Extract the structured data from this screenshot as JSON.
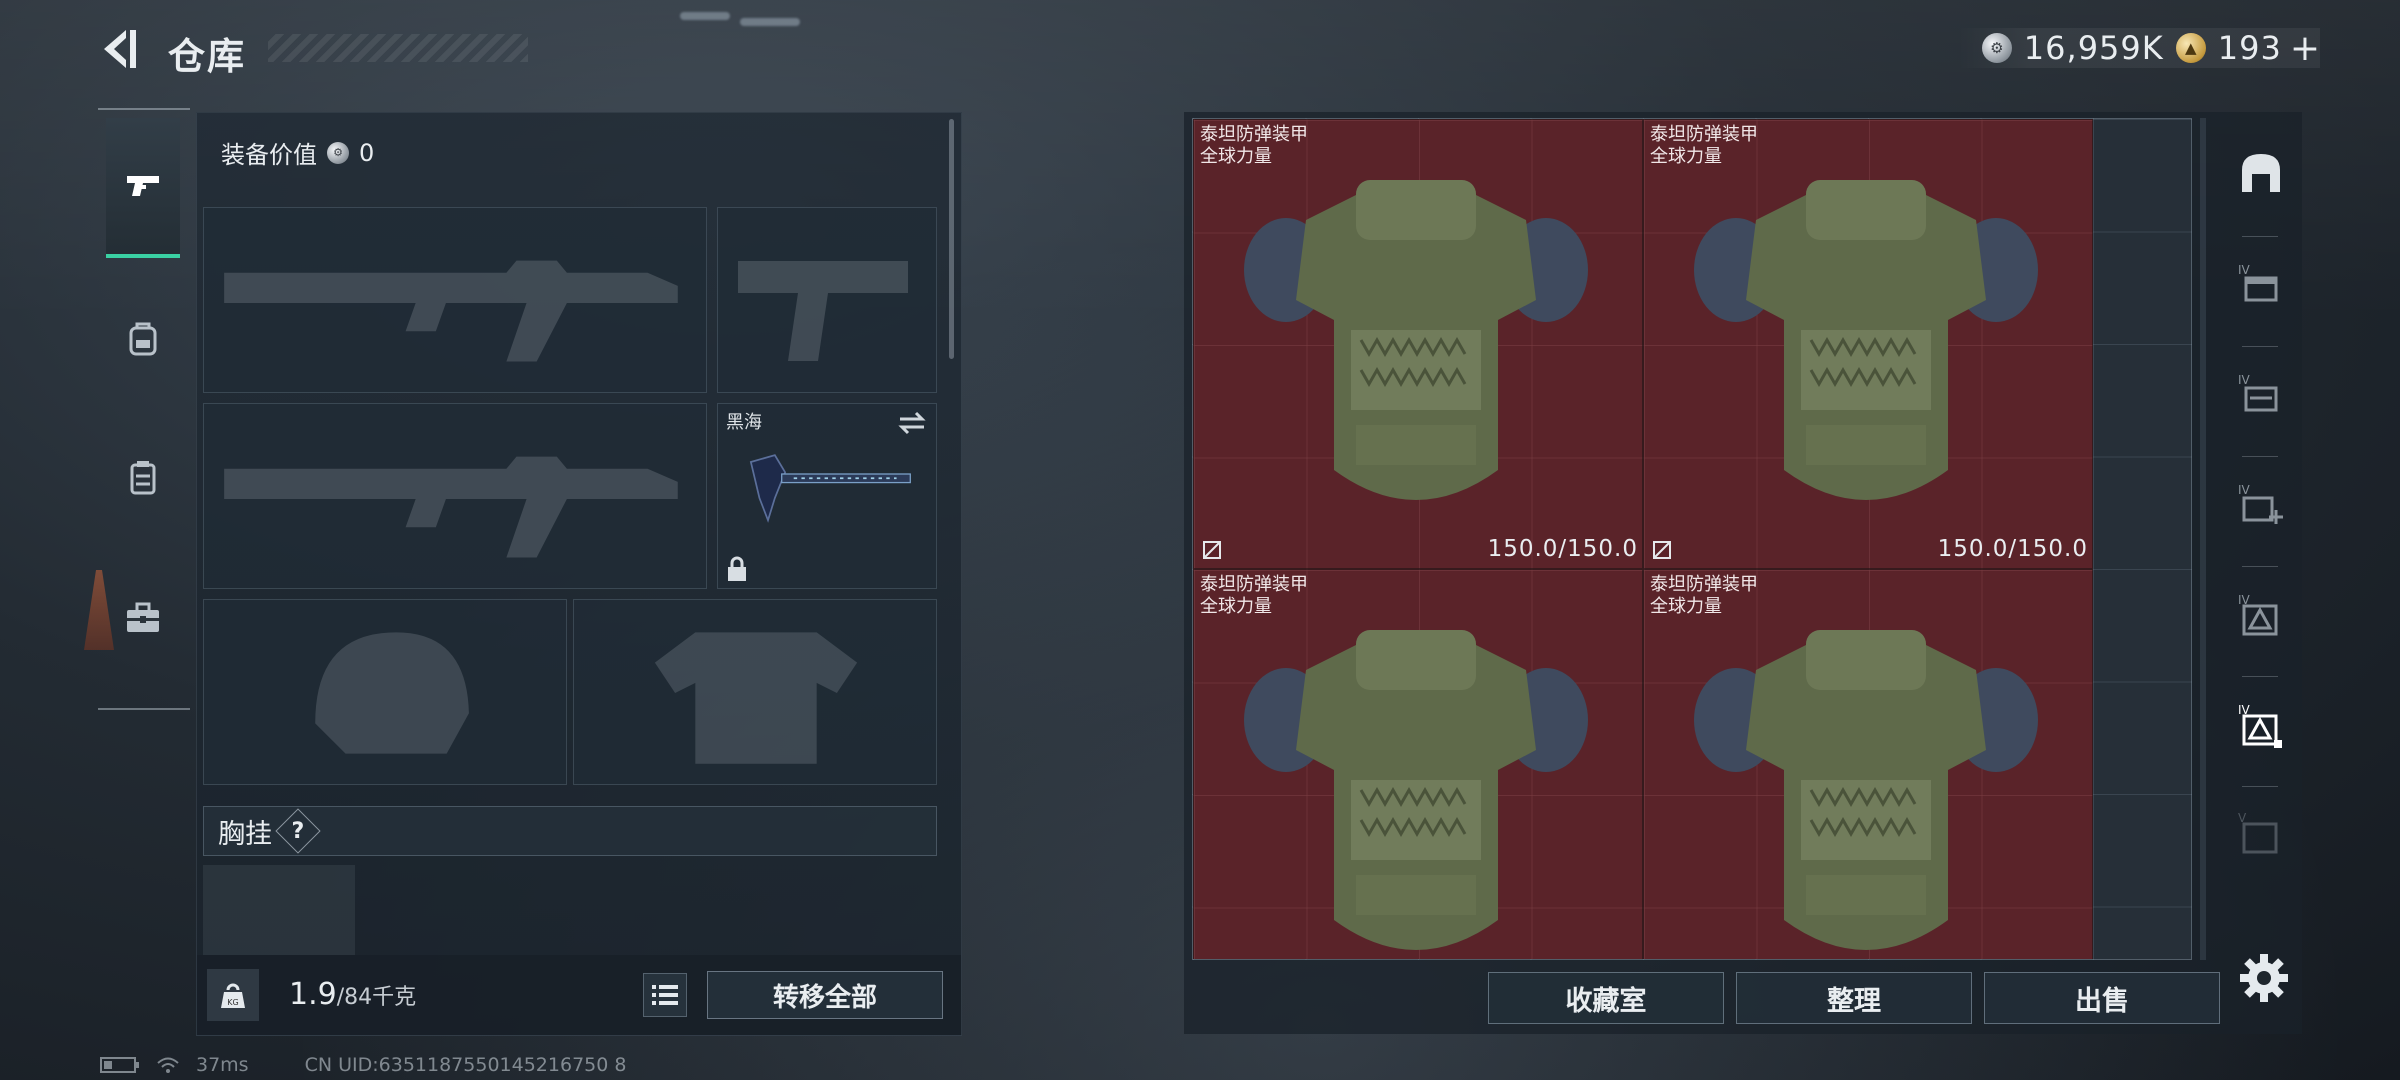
{
  "header": {
    "title": "仓库",
    "currency": {
      "silver": {
        "value": "16,959K",
        "icon": "silver-coin-icon"
      },
      "gold": {
        "value": "193",
        "icon": "gold-coin-icon"
      },
      "add_label": "+"
    }
  },
  "left_tabs": [
    {
      "icon": "pistol-icon",
      "active": true
    },
    {
      "icon": "backpack-icon",
      "active": false
    },
    {
      "icon": "chest-rig-icon",
      "active": false
    },
    {
      "icon": "toolbox-icon",
      "active": false
    }
  ],
  "equipment": {
    "value_label": "装备价值",
    "value": "0",
    "slots": [
      {
        "id": "primary-weapon-1",
        "label": "",
        "empty": true
      },
      {
        "id": "pistol",
        "label": "",
        "empty": true
      },
      {
        "id": "primary-weapon-2",
        "label": "",
        "empty": true
      },
      {
        "id": "melee",
        "label": "黑海",
        "empty": false,
        "locked": true
      },
      {
        "id": "helmet",
        "label": "",
        "empty": true
      },
      {
        "id": "body-armor",
        "label": "",
        "empty": true
      }
    ],
    "chest_rig_label": "胸挂",
    "chest_rig_help": "?",
    "weight": {
      "current": "1.9",
      "max": "/84千克",
      "unit_badge": "KG"
    },
    "transfer_all_label": "转移全部"
  },
  "storage": {
    "items": [
      {
        "name_line1": "泰坦防弹装甲",
        "name_line2": "全球力量",
        "durability": "150.0/150.0"
      },
      {
        "name_line1": "泰坦防弹装甲",
        "name_line2": "全球力量",
        "durability": "150.0/150.0"
      },
      {
        "name_line1": "泰坦防弹装甲",
        "name_line2": "全球力量",
        "durability": ""
      },
      {
        "name_line1": "泰坦防弹装甲",
        "name_line2": "全球力量",
        "durability": ""
      }
    ],
    "side_filters": [
      {
        "icon": "helmet-filter-icon",
        "tier": ""
      },
      {
        "icon": "storage-box-iv-icon",
        "tier": "IV"
      },
      {
        "icon": "storage-box-iv-2-icon",
        "tier": "IV"
      },
      {
        "icon": "medical-box-iv-icon",
        "tier": "IV"
      },
      {
        "icon": "container-iv-icon",
        "tier": "IV"
      },
      {
        "icon": "container-iv-active-icon",
        "tier": "IV"
      },
      {
        "icon": "container-v-icon",
        "tier": "V"
      }
    ],
    "actions": {
      "collection_label": "收藏室",
      "sort_label": "整理",
      "sell_label": "出售"
    }
  },
  "status": {
    "ping": "37ms",
    "uid": "CN UID:6351187550145216750 8"
  },
  "colors": {
    "accent": "#3ad1a3",
    "item_bg": "#5a2329"
  }
}
